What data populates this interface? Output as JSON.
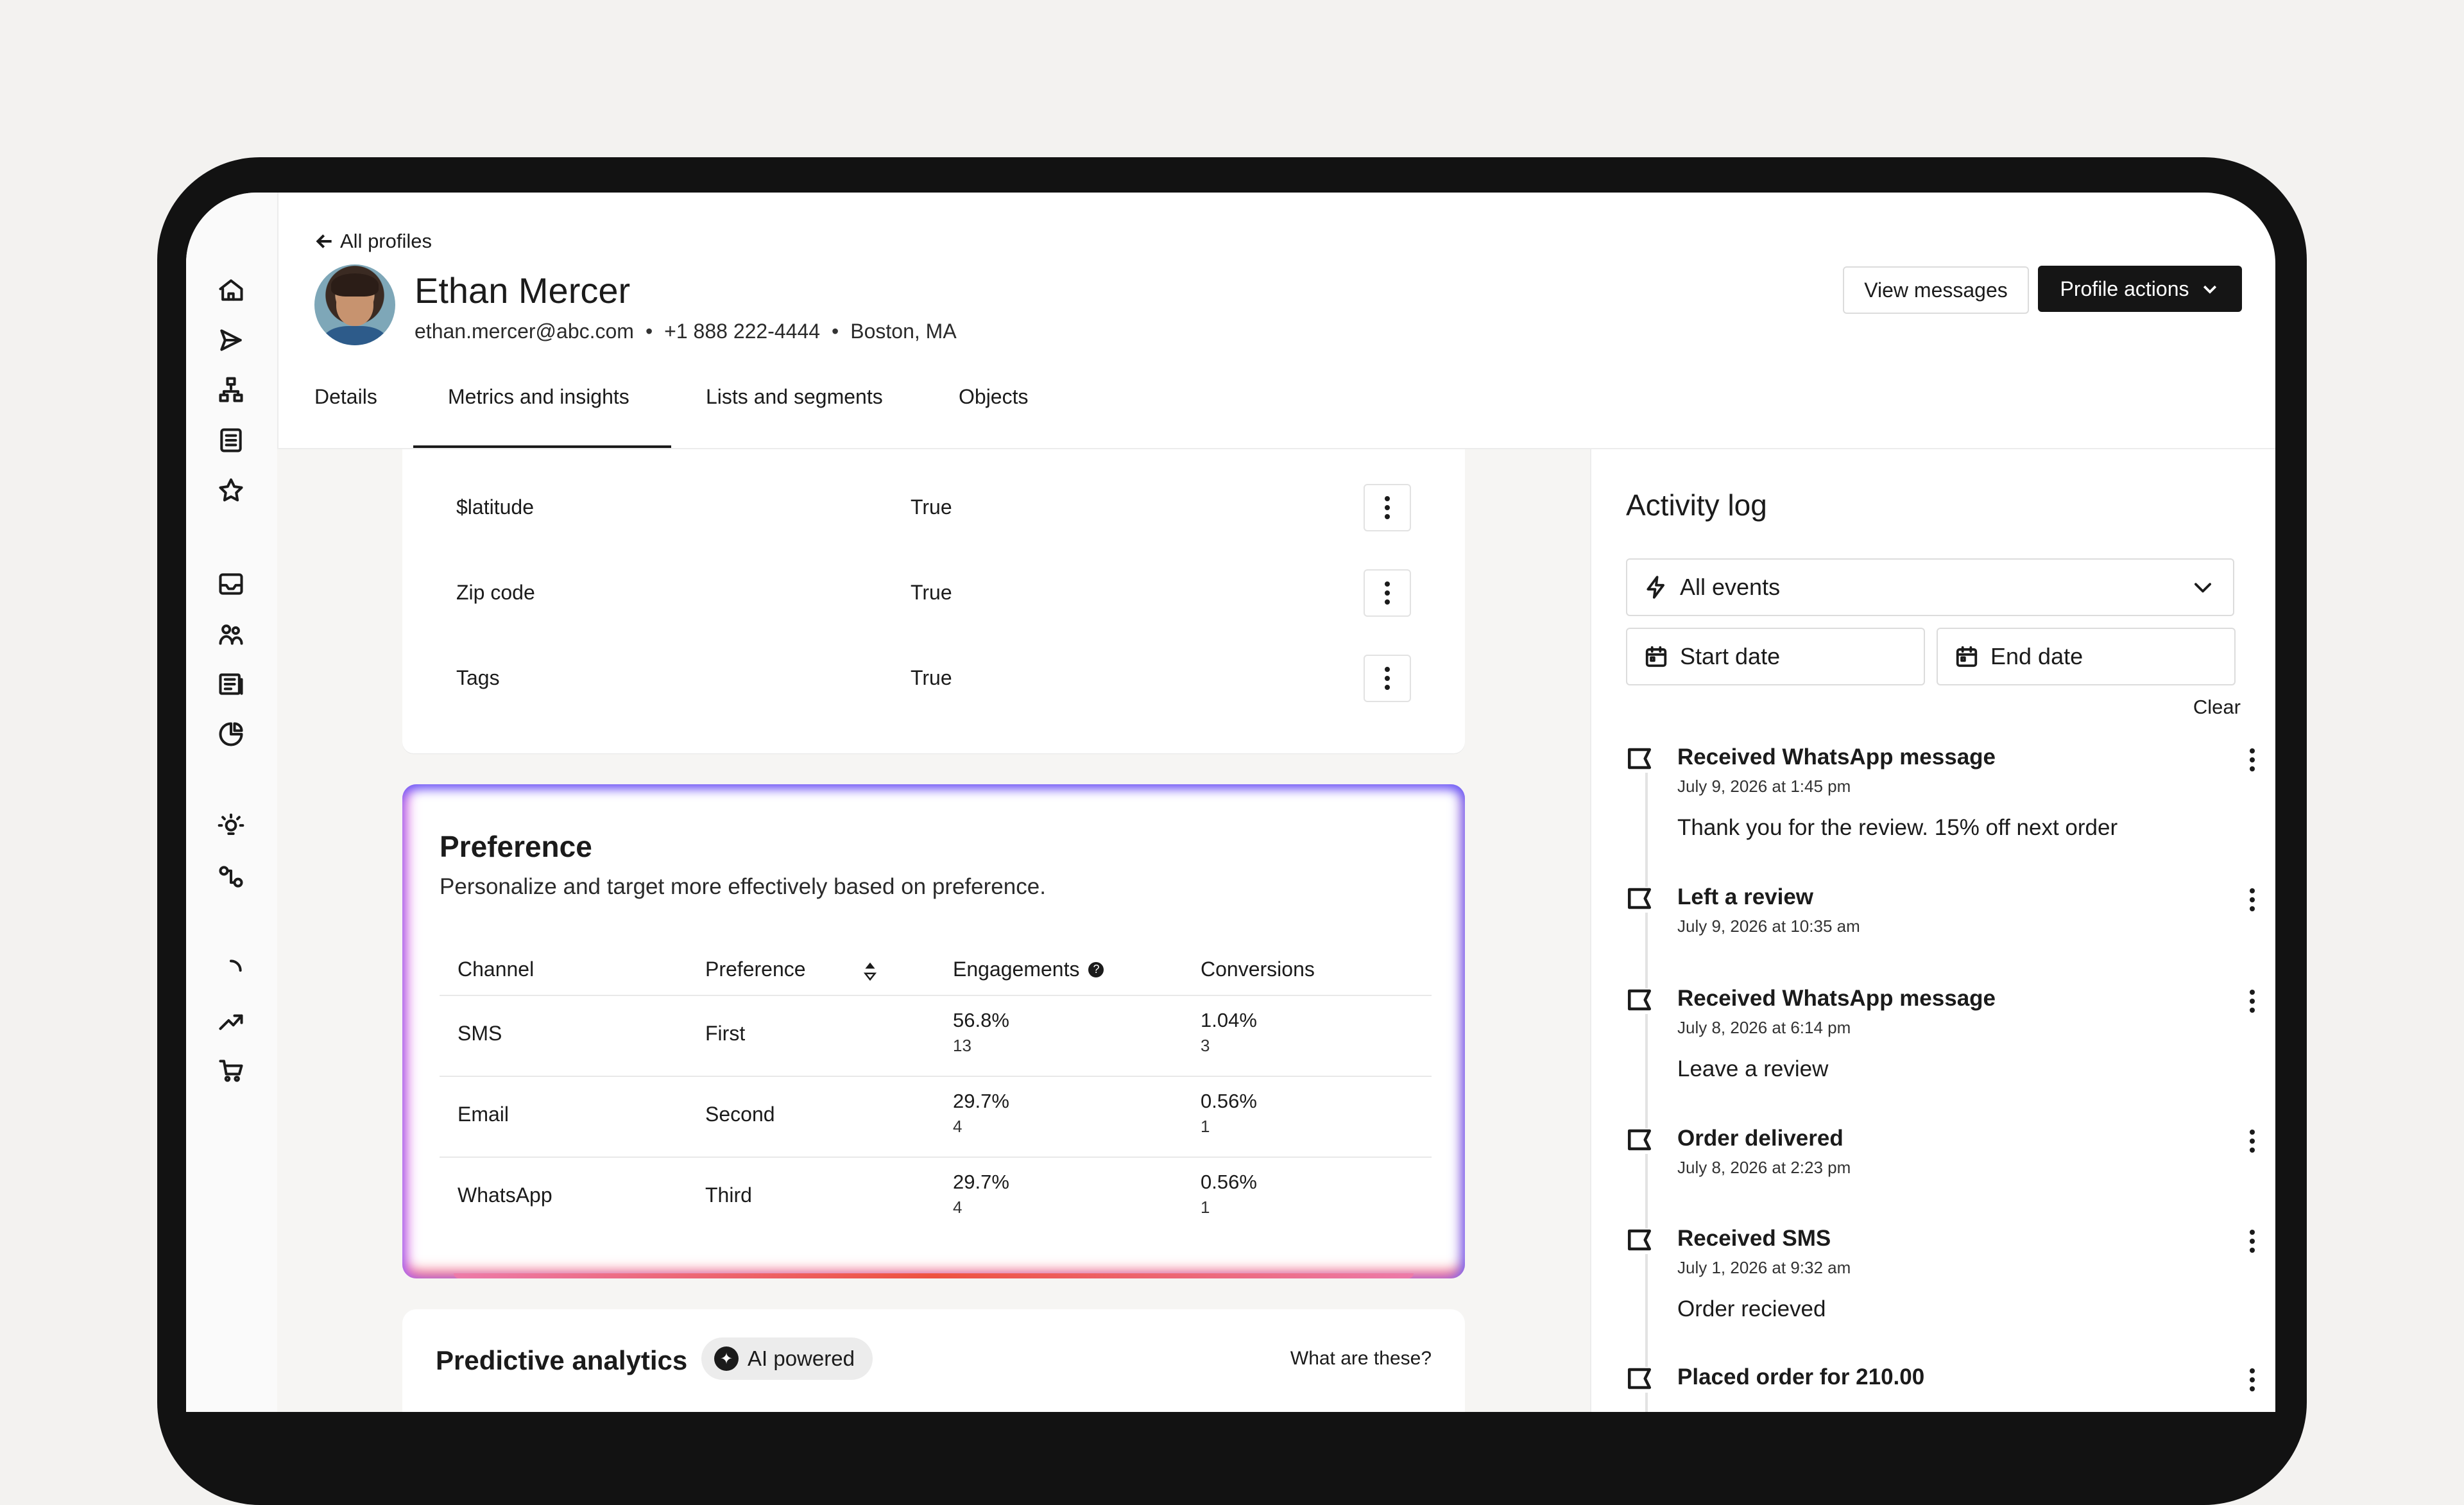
{
  "header": {
    "back_label": "All profiles",
    "name": "Ethan Mercer",
    "email": "ethan.mercer@abc.com",
    "phone": "+1 888 222-4444",
    "location": "Boston, MA",
    "separator": "•",
    "view_messages": "View messages",
    "profile_actions": "Profile actions"
  },
  "tabs": [
    "Details",
    "Metrics and insights",
    "Lists and segments",
    "Objects"
  ],
  "active_tab": "Metrics and insights",
  "attributes": [
    {
      "key": "$latitude",
      "value": "True"
    },
    {
      "key": "Zip code",
      "value": "True"
    },
    {
      "key": "Tags",
      "value": "True"
    }
  ],
  "preference": {
    "title": "Preference",
    "subtitle": "Personalize and target more effectively based on preference.",
    "columns": [
      "Channel",
      "Preference",
      "Engagements",
      "Conversions"
    ],
    "rows": [
      {
        "channel": "SMS",
        "preference": "First",
        "eng_pct": "56.8%",
        "eng_count": "13",
        "conv_pct": "1.04%",
        "conv_count": "3"
      },
      {
        "channel": "Email",
        "preference": "Second",
        "eng_pct": "29.7%",
        "eng_count": "4",
        "conv_pct": "0.56%",
        "conv_count": "1"
      },
      {
        "channel": "WhatsApp",
        "preference": "Third",
        "eng_pct": "29.7%",
        "eng_count": "4",
        "conv_pct": "0.56%",
        "conv_count": "1"
      }
    ]
  },
  "predictive": {
    "title": "Predictive analytics",
    "badge": "AI powered",
    "link": "What are these?"
  },
  "activity": {
    "title": "Activity log",
    "filter_value": "All events",
    "start_date": "Start date",
    "end_date": "End date",
    "clear": "Clear",
    "events": [
      {
        "title": "Received WhatsApp message",
        "date": "July 9, 2026 at 1:45 pm",
        "body": "Thank you for the review. 15% off next order"
      },
      {
        "title": "Left a review",
        "date": "July 9, 2026 at 10:35 am",
        "body": ""
      },
      {
        "title": "Received WhatsApp message",
        "date": "July 8, 2026 at 6:14 pm",
        "body": "Leave a review"
      },
      {
        "title": "Order delivered",
        "date": "July 8, 2026 at 2:23 pm",
        "body": ""
      },
      {
        "title": "Received SMS",
        "date": "July 1, 2026 at 9:32 am",
        "body": "Order recieved"
      },
      {
        "title": "Placed order for 210.00",
        "date": "",
        "body": ""
      }
    ]
  },
  "colors": {
    "accent_dark": "#151515",
    "gradient_purple": "#6b5cf6",
    "gradient_pink": "#d36cf3",
    "gradient_red": "#f24b2a"
  },
  "rail_icons": [
    "home-icon",
    "send-icon",
    "flow-icon",
    "list-icon",
    "star-icon",
    "inbox-icon",
    "audience-icon",
    "content-icon",
    "analytics-icon",
    "insights-icon",
    "integration-icon",
    "loading-icon",
    "trend-icon",
    "cart-icon"
  ]
}
